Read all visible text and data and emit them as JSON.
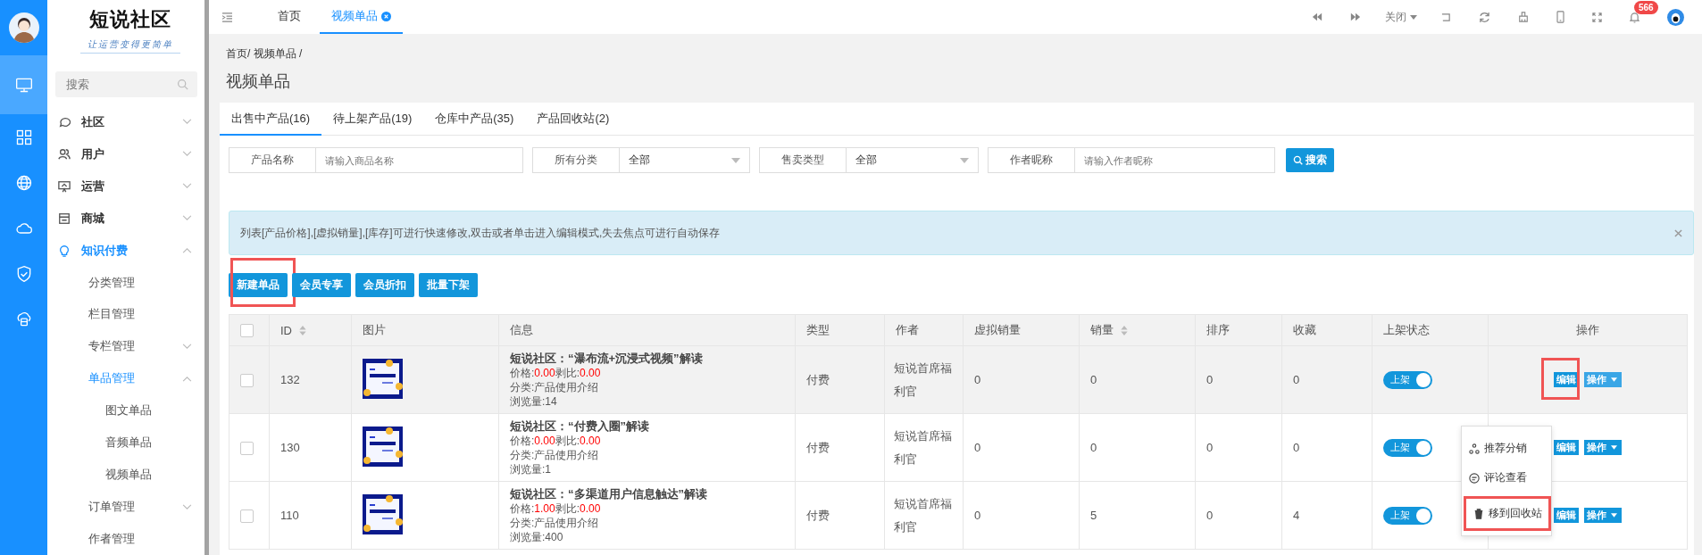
{
  "rail": {
    "items": [
      {
        "selected": true
      },
      {
        "selected": false
      },
      {
        "selected": false
      },
      {
        "selected": false
      },
      {
        "selected": false
      },
      {
        "selected": false
      }
    ]
  },
  "sidebar": {
    "logo": "短说社区",
    "slogan": "让运营变得更简单",
    "search": {
      "placeholder": "搜索"
    },
    "items": [
      {
        "label": "社区",
        "selected": false,
        "expanded": false
      },
      {
        "label": "用户",
        "selected": false,
        "expanded": false
      },
      {
        "label": "运营",
        "selected": false,
        "expanded": false
      },
      {
        "label": "商城",
        "selected": false,
        "expanded": false
      },
      {
        "label": "知识付费",
        "selected": true,
        "expanded": true,
        "children": [
          {
            "label": "分类管理",
            "selected": false
          },
          {
            "label": "栏目管理",
            "selected": false
          },
          {
            "label": "专栏管理",
            "selected": false,
            "expanded": false
          },
          {
            "label": "单品管理",
            "selected": true,
            "expanded": true,
            "children": [
              {
                "label": "图文单品",
                "selected": false
              },
              {
                "label": "音频单品",
                "selected": false
              },
              {
                "label": "视频单品",
                "selected": false
              }
            ]
          },
          {
            "label": "订单管理",
            "selected": false,
            "expanded": false
          },
          {
            "label": "作者管理",
            "selected": false
          }
        ]
      }
    ]
  },
  "topbar": {
    "tabs": [
      {
        "label": "首页",
        "selected": false,
        "closable": false
      },
      {
        "label": "视频单品",
        "selected": true,
        "closable": true
      }
    ],
    "close_menu": "关闭",
    "notification_count": "566"
  },
  "page": {
    "breadcrumb": "首页/ 视频单品 /",
    "title": "视频单品"
  },
  "tabs": [
    {
      "label": "出售中产品(16)",
      "selected": true
    },
    {
      "label": "待上架产品(19)",
      "selected": false
    },
    {
      "label": "仓库中产品(35)",
      "selected": false
    },
    {
      "label": "产品回收站(2)",
      "selected": false
    }
  ],
  "filters": [
    {
      "kind": "input",
      "label": "产品名称",
      "placeholder": "请输入商品名称"
    },
    {
      "kind": "select",
      "label": "所有分类",
      "value": "全部"
    },
    {
      "kind": "select",
      "label": "售卖类型",
      "value": "全部"
    },
    {
      "kind": "input",
      "label": "作者昵称",
      "placeholder": "请输入作者昵称"
    }
  ],
  "search_button": "搜索",
  "alert": {
    "text": "列表[产品价格],[虚拟销量],[库存]可进行快速修改,双击或者单击进入编辑模式,失去焦点可进行自动保存"
  },
  "actions": [
    {
      "label": "新建单品",
      "highlighted": true
    },
    {
      "label": "会员专享",
      "highlighted": false
    },
    {
      "label": "会员折扣",
      "highlighted": false
    },
    {
      "label": "批量下架",
      "highlighted": false
    }
  ],
  "table": {
    "select_all": {
      "checked": false
    },
    "columns": [
      {
        "label": "ID",
        "sortable": true
      },
      {
        "label": "图片",
        "sortable": false
      },
      {
        "label": "信息",
        "sortable": false
      },
      {
        "label": "类型",
        "sortable": false
      },
      {
        "label": "作者",
        "sortable": false
      },
      {
        "label": "虚拟销量",
        "sortable": false
      },
      {
        "label": "销量",
        "sortable": true
      },
      {
        "label": "排序",
        "sortable": false
      },
      {
        "label": "收藏",
        "sortable": false
      },
      {
        "label": "上架状态",
        "sortable": false
      },
      {
        "label": "操作",
        "sortable": false
      }
    ],
    "rows": [
      {
        "checked": false,
        "hovered": true,
        "id": "132",
        "title": "短说社区：“瀑布流+沉浸式视频”解读",
        "price_label": "价格:",
        "price": "0.00",
        "ratio_label": "剥比:",
        "ratio": "0.00",
        "category": "分类:产品使用介绍",
        "views": "浏览量:14",
        "type": "付费",
        "author": "短说首席福利官",
        "virtual_sales": "0",
        "sales": "0",
        "order": "0",
        "favorites": "0",
        "status": {
          "label": "上架",
          "on": true
        },
        "edit": {
          "label": "编辑",
          "highlighted": true
        },
        "more": "操作"
      },
      {
        "checked": false,
        "hovered": false,
        "id": "130",
        "title": "短说社区：“付费入圈”解读",
        "price_label": "价格:",
        "price": "0.00",
        "ratio_label": "剥比:",
        "ratio": "0.00",
        "category": "分类:产品使用介绍",
        "views": "浏览量:1",
        "type": "付费",
        "author": "短说首席福利官",
        "virtual_sales": "0",
        "sales": "0",
        "order": "0",
        "favorites": "0",
        "status": {
          "label": "上架",
          "on": true
        },
        "edit": {
          "label": "编辑",
          "highlighted": false
        },
        "more": "操作"
      },
      {
        "checked": false,
        "hovered": false,
        "id": "110",
        "title": "短说社区：“多渠道用户信息触达”解读",
        "price_label": "价格:",
        "price": "1.00",
        "ratio_label": "剥比:",
        "ratio": "0.00",
        "category": "分类:产品使用介绍",
        "views": "浏览量:400",
        "type": "付费",
        "author": "短说首席福利官",
        "virtual_sales": "0",
        "sales": "5",
        "order": "0",
        "favorites": "4",
        "status": {
          "label": "上架",
          "on": true
        },
        "edit": {
          "label": "编辑",
          "highlighted": false
        },
        "more": "操作"
      }
    ]
  },
  "dropdown": {
    "items": [
      {
        "label": "推荐分销",
        "highlighted": false
      },
      {
        "label": "评论查看",
        "highlighted": false
      },
      {
        "label": "移到回收站",
        "highlighted": true
      }
    ]
  }
}
